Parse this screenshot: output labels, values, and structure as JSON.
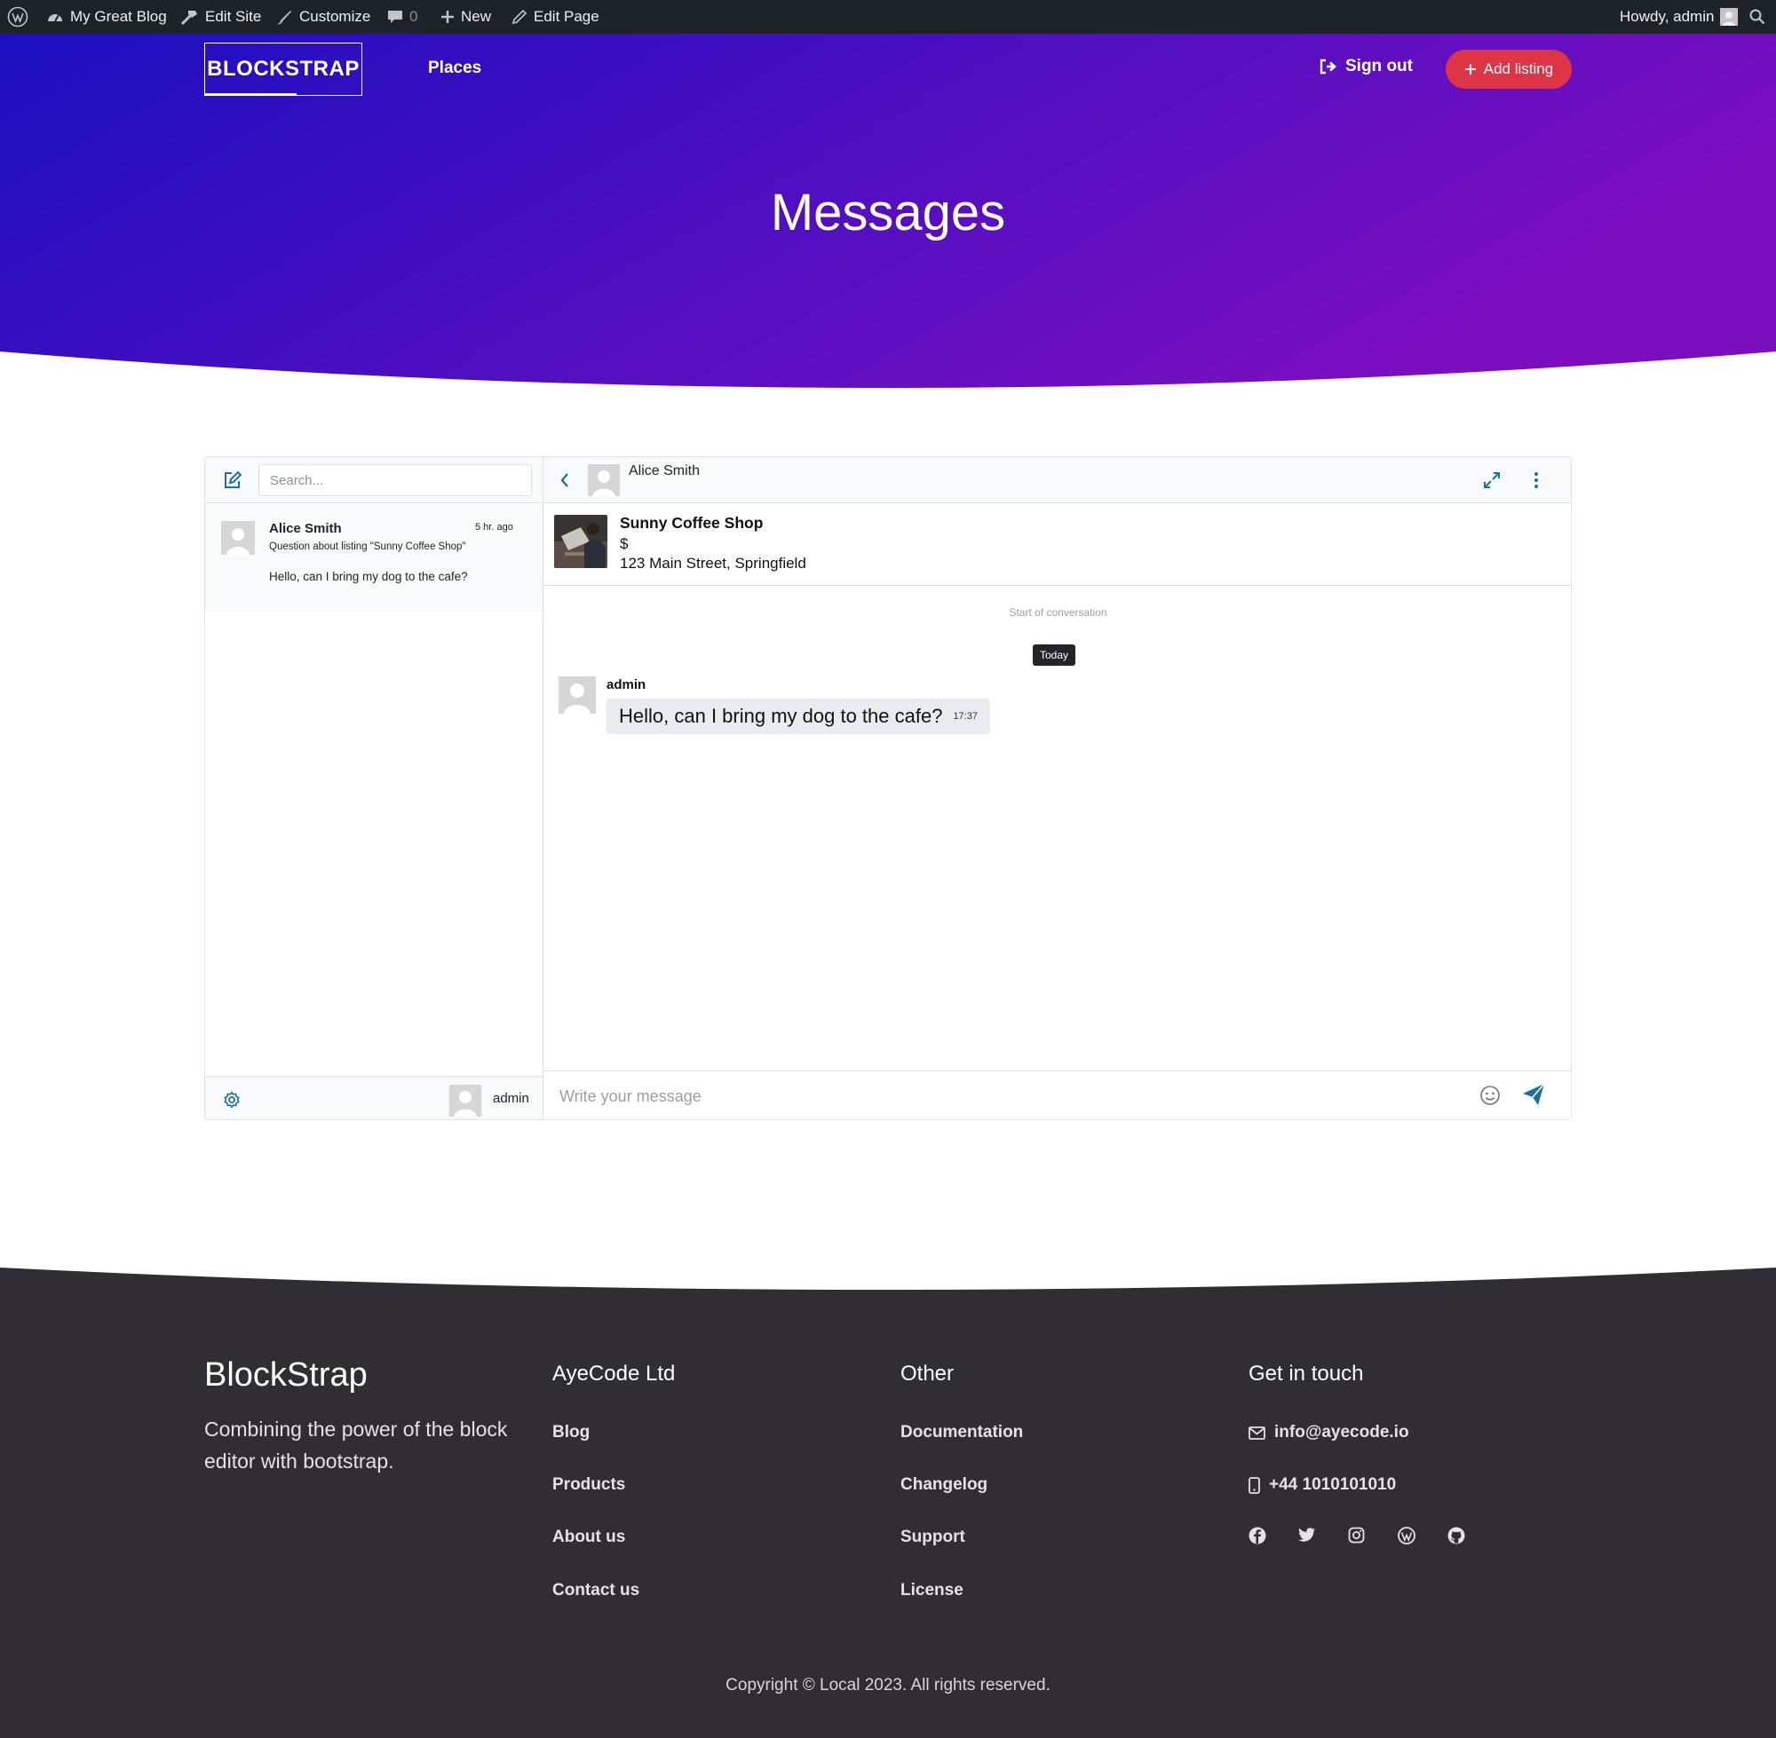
{
  "admin_bar": {
    "site_name": "My Great Blog",
    "edit_site": "Edit Site",
    "customize": "Customize",
    "comments_count": "0",
    "new_label": "New",
    "edit_page": "Edit Page",
    "greeting": "Howdy, admin"
  },
  "header": {
    "logo": "BLOCKSTRAP",
    "nav": [
      "Places"
    ],
    "sign_out": "Sign out",
    "add_listing": "Add listing",
    "page_title": "Messages",
    "gradient": {
      "from": "#1a0fbf",
      "to": "#7b0fc0"
    },
    "accent_color": "#dc3545"
  },
  "messenger": {
    "search_placeholder": "Search...",
    "conversations": [
      {
        "name": "Alice Smith",
        "time": "5 hr. ago",
        "subject": "Question about listing \"Sunny Coffee Shop\"",
        "preview": "Hello, can I bring my dog to the cafe?"
      }
    ],
    "current_user": "admin",
    "active_contact": "Alice Smith",
    "listing": {
      "title": "Sunny Coffee Shop",
      "price": "$",
      "address": "123 Main Street, Springfield"
    },
    "start_label": "Start of conversation",
    "day_label": "Today",
    "messages": [
      {
        "author": "admin",
        "text": "Hello, can I bring my dog to the cafe?",
        "time": "17:37"
      }
    ],
    "input_placeholder": "Write your message",
    "icon_color": "#1f6e9c"
  },
  "footer": {
    "brand": "BlockStrap",
    "tagline": "Combining the power of the block editor with bootstrap.",
    "columns": [
      {
        "title": "AyeCode Ltd",
        "links": [
          "Blog",
          "Products",
          "About us",
          "Contact us"
        ]
      },
      {
        "title": "Other",
        "links": [
          "Documentation",
          "Changelog",
          "Support",
          "License"
        ]
      }
    ],
    "contact_title": "Get in touch",
    "email": "info@ayecode.io",
    "phone": "+44 1010101010",
    "social_icons": [
      "facebook-icon",
      "twitter-icon",
      "instagram-icon",
      "wordpress-icon",
      "github-icon"
    ],
    "copyright": "Copyright © Local 2023. All rights reserved.",
    "background": "#312e33"
  }
}
